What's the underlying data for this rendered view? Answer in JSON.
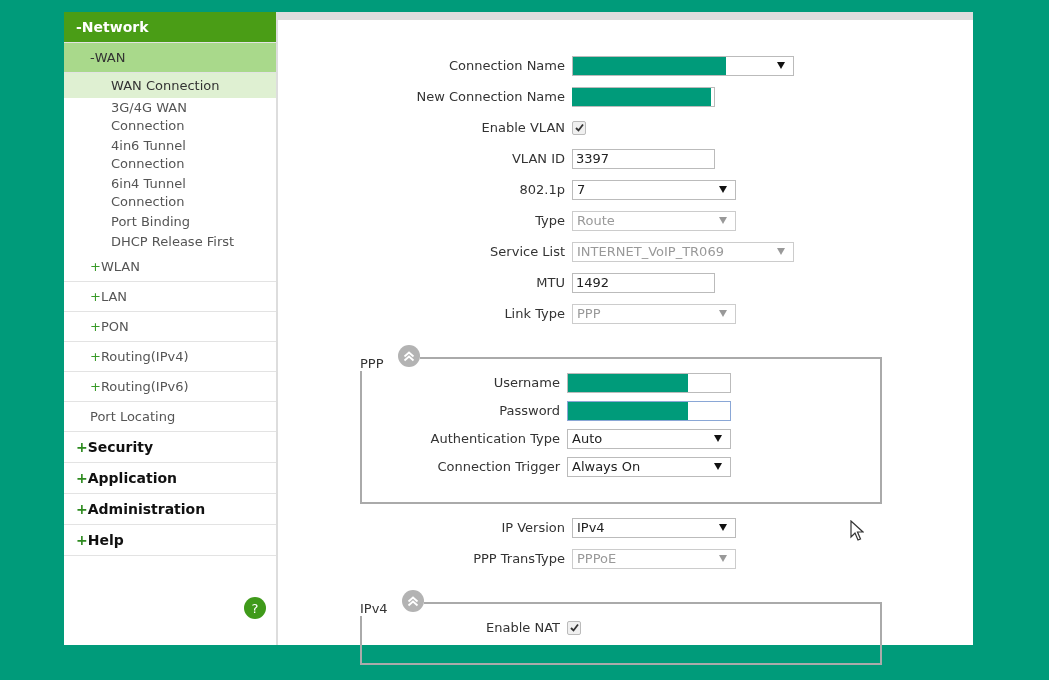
{
  "sidebar": {
    "items": [
      {
        "marker": "-",
        "label": "Network",
        "selected": false,
        "children": [
          {
            "marker": "-",
            "label": "WAN",
            "selected": false,
            "children": [
              {
                "label": "WAN Connection",
                "selected": true
              },
              {
                "label": "3G/4G WAN Connection",
                "selected": false
              },
              {
                "label": "4in6 Tunnel Connection",
                "selected": false
              },
              {
                "label": "6in4 Tunnel Connection",
                "selected": false
              },
              {
                "label": "Port Binding",
                "selected": false
              },
              {
                "label": "DHCP Release First",
                "selected": false
              }
            ]
          },
          {
            "marker": "+",
            "label": "WLAN",
            "selected": false
          },
          {
            "marker": "+",
            "label": "LAN",
            "selected": false
          },
          {
            "marker": "+",
            "label": "PON",
            "selected": false
          },
          {
            "marker": "+",
            "label": "Routing(IPv4)",
            "selected": false
          },
          {
            "marker": "+",
            "label": "Routing(IPv6)",
            "selected": false
          },
          {
            "label": "Port Locating",
            "selected": false
          }
        ]
      },
      {
        "marker": "+",
        "label": "Security",
        "selected": false
      },
      {
        "marker": "+",
        "label": "Application",
        "selected": false
      },
      {
        "marker": "+",
        "label": "Administration",
        "selected": false
      },
      {
        "marker": "+",
        "label": "Help",
        "selected": false
      }
    ]
  },
  "help_button": {
    "label": "?"
  },
  "form": [
    {
      "kind": "dropdown",
      "label": "Connection Name",
      "redacted": true,
      "disabled": false
    },
    {
      "kind": "text",
      "label": "New Connection Name",
      "redacted": true
    },
    {
      "kind": "checkbox",
      "label": "Enable VLAN",
      "checked": true
    },
    {
      "kind": "text",
      "label": "VLAN ID",
      "value": "3397"
    },
    {
      "kind": "dropdown",
      "label": "802.1p",
      "value": "7",
      "disabled": false
    },
    {
      "kind": "dropdown",
      "label": "Type",
      "value": "Route",
      "disabled": true
    },
    {
      "kind": "dropdown",
      "label": "Service List",
      "value": "INTERNET_VoIP_TR069",
      "disabled": true
    },
    {
      "kind": "text",
      "label": "MTU",
      "value": "1492"
    },
    {
      "kind": "dropdown",
      "label": "Link Type",
      "value": "PPP",
      "disabled": true
    },
    {
      "kind": "section",
      "title": "PPP",
      "fields": [
        {
          "kind": "text",
          "label": "Username",
          "redacted": true,
          "focused": false
        },
        {
          "kind": "text",
          "label": "Password",
          "redacted": true,
          "focused": true
        },
        {
          "kind": "dropdown",
          "label": "Authentication Type",
          "value": "Auto",
          "disabled": false
        },
        {
          "kind": "dropdown",
          "label": "Connection Trigger",
          "value": "Always On",
          "disabled": false
        }
      ]
    },
    {
      "kind": "dropdown",
      "label": "IP Version",
      "value": "IPv4",
      "disabled": false
    },
    {
      "kind": "dropdown",
      "label": "PPP TransType",
      "value": "PPPoE",
      "disabled": true
    },
    {
      "kind": "section",
      "title": "IPv4",
      "fields": [
        {
          "kind": "checkbox",
          "label": "Enable NAT",
          "checked": true
        }
      ]
    }
  ]
}
